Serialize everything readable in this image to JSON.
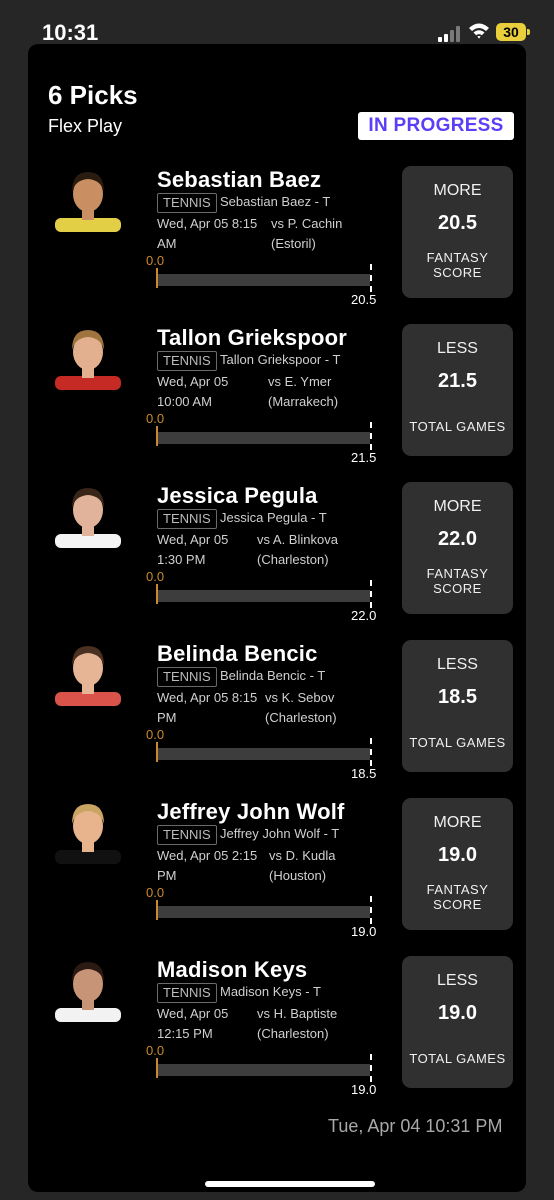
{
  "status_bar": {
    "time": "10:31",
    "battery": "30"
  },
  "header": {
    "title": "6 Picks",
    "subtitle": "Flex Play",
    "status_badge": "IN PROGRESS"
  },
  "picks": [
    {
      "name": "Sebastian Baez",
      "sport": "TENNIS",
      "pick_label": "Sebastian Baez - T",
      "date_line1": "Wed, Apr 05 8:15",
      "date_line2": "AM",
      "opponent": "vs P. Cachin",
      "event": "(Estoril)",
      "current": "0.0",
      "line": "20.5",
      "direction": "MORE",
      "stat_line1": "FANTASY",
      "stat_line2": "SCORE",
      "progress": 0.0,
      "avatar": {
        "skin": "#c98f62",
        "hair": "#2a1b10",
        "shirt": "#e3cf45"
      }
    },
    {
      "name": "Tallon Griekspoor",
      "sport": "TENNIS",
      "pick_label": "Tallon Griekspoor - T",
      "date_line1": "Wed, Apr 05",
      "date_line2": "10:00 AM",
      "opponent": "vs E. Ymer",
      "event": "(Marrakech)",
      "current": "0.0",
      "line": "21.5",
      "direction": "LESS",
      "stat_line1": "TOTAL GAMES",
      "stat_line2": "",
      "progress": 0.0,
      "avatar": {
        "skin": "#e2b08f",
        "hair": "#a0743e",
        "shirt": "#c62a24"
      }
    },
    {
      "name": "Jessica Pegula",
      "sport": "TENNIS",
      "pick_label": "Jessica Pegula - T",
      "date_line1": "Wed, Apr 05",
      "date_line2": "1:30 PM",
      "opponent": "vs A. Blinkova",
      "event": "(Charleston)",
      "current": "0.0",
      "line": "22.0",
      "direction": "MORE",
      "stat_line1": "FANTASY",
      "stat_line2": "SCORE",
      "progress": 0.0,
      "avatar": {
        "skin": "#e0b39a",
        "hair": "#3a2618",
        "shirt": "#f4f4f4"
      }
    },
    {
      "name": "Belinda Bencic",
      "sport": "TENNIS",
      "pick_label": "Belinda Bencic - T",
      "date_line1": "Wed, Apr 05 8:15",
      "date_line2": "PM",
      "opponent": "vs K. Sebov",
      "event": "(Charleston)",
      "current": "0.0",
      "line": "18.5",
      "direction": "LESS",
      "stat_line1": "TOTAL GAMES",
      "stat_line2": "",
      "progress": 0.0,
      "avatar": {
        "skin": "#e6b596",
        "hair": "#4a3020",
        "shirt": "#d9534a"
      }
    },
    {
      "name": "Jeffrey John Wolf",
      "sport": "TENNIS",
      "pick_label": "Jeffrey John Wolf - T",
      "date_line1": "Wed, Apr 05 2:15",
      "date_line2": "PM",
      "opponent": "vs D. Kudla",
      "event": "(Houston)",
      "current": "0.0",
      "line": "19.0",
      "direction": "MORE",
      "stat_line1": "FANTASY",
      "stat_line2": "SCORE",
      "progress": 0.0,
      "avatar": {
        "skin": "#e7b48e",
        "hair": "#c9a463",
        "shirt": "#111111"
      }
    },
    {
      "name": "Madison Keys",
      "sport": "TENNIS",
      "pick_label": "Madison Keys - T",
      "date_line1": "Wed, Apr 05",
      "date_line2": "12:15 PM",
      "opponent": "vs H. Baptiste",
      "event": "(Charleston)",
      "current": "0.0",
      "line": "19.0",
      "direction": "LESS",
      "stat_line1": "TOTAL GAMES",
      "stat_line2": "",
      "progress": 0.0,
      "avatar": {
        "skin": "#c89477",
        "hair": "#2a1a12",
        "shirt": "#f2f2f2"
      }
    }
  ],
  "footer": {
    "timestamp": "Tue, Apr 04 10:31 PM"
  }
}
